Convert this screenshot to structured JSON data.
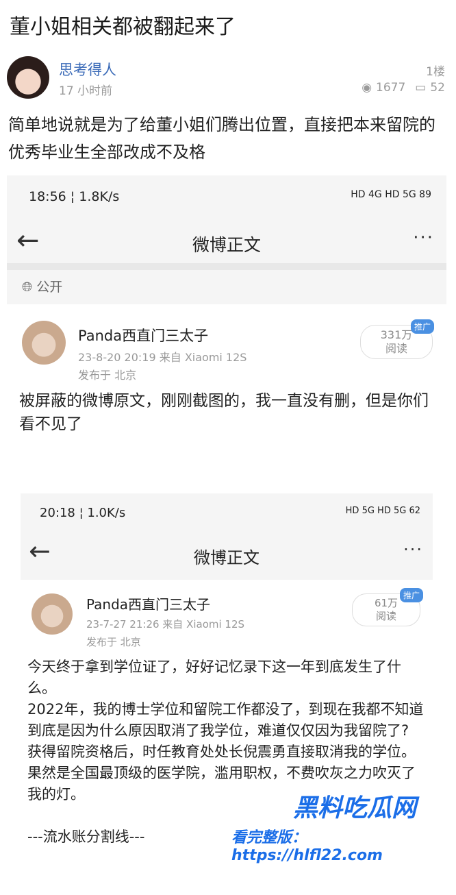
{
  "post": {
    "title": "董小姐相关都被翻起来了",
    "author": "思考得人",
    "time": "17 小时前",
    "floor": "1楼",
    "views": "1677",
    "comments": "52",
    "text": "简单地说就是为了给董小姐们腾出位置，直接把本来留院的优秀毕业生全部改成不及格"
  },
  "shot1": {
    "status_time": "18:56 ¦ 1.8K/s",
    "status_right": "HD 4G HD 5G 89",
    "nav_title": "微博正文",
    "more": "···",
    "public": "公开",
    "poster": "Panda西直门三太子",
    "meta": "23-8-20 20:19  来自 Xiaomi 12S",
    "location": "发布于 北京",
    "promo": "推广",
    "reads": "331万",
    "reads_label": "阅读",
    "text": "被屏蔽的微博原文，刚刚截图的，我一直没有删，但是你们看不见了"
  },
  "shot2": {
    "status_time": "20:18 ¦ 1.0K/s",
    "status_right": "HD 5G HD 5G 62",
    "nav_title": "微博正文",
    "more": "···",
    "poster": "Panda西直门三太子",
    "meta": "23-7-27 21:26  来自 Xiaomi 12S",
    "location": "发布于 北京",
    "promo": "推广",
    "reads": "61万",
    "reads_label": "阅读",
    "paragraphs": [
      "今天终于拿到学位证了，好好记忆录下这一年到底发生了什么。",
      "2022年，我的博士学位和留院工作都没了，到现在我都不知道到底是因为什么原因取消了我学位，难道仅仅因为我留院了?",
      "获得留院资格后，时任教育处处长倪震勇直接取消我的学位。",
      "果然是全国最顶级的医学院，滥用职权，不费吹灰之力吹灭了我的灯。",
      "",
      "---流水账分割线---"
    ]
  },
  "watermark": {
    "line1": "黑料吃瓜网",
    "line2": "看完整版：https://hlfl22.com"
  }
}
